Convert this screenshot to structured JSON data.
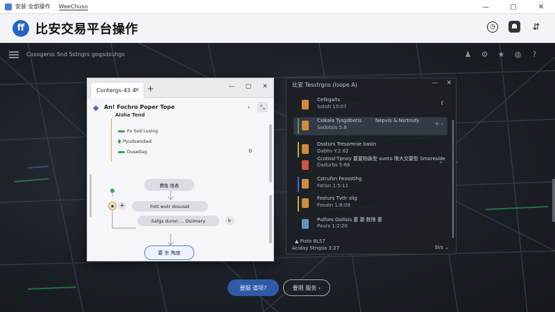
{
  "os_bar": {
    "app_name": "安装 全部操作",
    "tab_label": "WeeChuso",
    "minimize": "—",
    "maximize": "▢",
    "close": "✕"
  },
  "header": {
    "logo_glyph": "ff",
    "title": "比安交易平台操作",
    "icons": [
      "clock-icon",
      "bot-icon",
      "expand-icon"
    ]
  },
  "nav": {
    "breadcrumb": "Cosogerss Snd Sstngrs gogsdsuhgs",
    "icons": [
      "user-icon",
      "settings-icon",
      "star-icon",
      "globe-icon",
      "question-icon"
    ]
  },
  "left_window": {
    "tab_label": "Contergs-43 4",
    "tab_close": "×",
    "new_tab": "+",
    "controls": {
      "minimize": "—",
      "maximize": "▢",
      "close": "✕"
    },
    "title": "An! Fochro Poper Tope",
    "subtitle": "Aisha Tend",
    "tree_items": [
      "Fo Sod Lusing",
      "Pyudswsdwd",
      "Dusetlag"
    ],
    "tools": [
      "‹",
      "⤡"
    ],
    "flow": {
      "node_top": "費售 限表",
      "node_mid": "Fott   wutr dosuset",
      "node_low": "Safgs  duron ... Dsiimery",
      "node_low_badge": "b",
      "node_bottom": "要 东 陶度",
      "plus": "+"
    }
  },
  "right_panel": {
    "title": "比安 Tesstrgns (lsope A)",
    "controls": {
      "minimize": "—",
      "close": "✕"
    },
    "rows": [
      {
        "line1": "Cetkgaits",
        "line2": "Sotoh 15:07",
        "right": "ℓ",
        "color": "#d58a3b",
        "bar": ""
      },
      {
        "line1": "Cslkala Tysgdbetis",
        "line2": "Sodotsis 5:8",
        "right": "Nepvis & Nsrtnufy",
        "right2": "+ ›",
        "color": "#d58a3b",
        "bar": "#39a64a",
        "highlight": true
      },
      {
        "line1": "Dssturs Tresomnie basin",
        "line2": "Dabhs Y:2 62",
        "right": "",
        "color": "#d58a3b",
        "bar": "#d5a43b"
      },
      {
        "line1": "Ccotoal-Tpnoy 要要物装型 sunto 限大交要型 Smoreslde",
        "line2": "Dadurbs 5:66",
        "right": "⌄",
        "color": "#d3533b",
        "bar": ""
      },
      {
        "line1": "Cstrufsn Feosstihg",
        "line2": "Fatisn 1:5:11",
        "right": "",
        "color": "#d58a3b",
        "bar": "#3b6ed5"
      },
      {
        "line1": "Fosturs Tvtlr slig",
        "line2": "Fosatn 1:8:08",
        "right": "",
        "color": "#d58a3b",
        "bar": "#d5a43b"
      },
      {
        "line1": "Pulfors Gsilisis 要 要 数限 要",
        "line2": "Paurs 1:2:20",
        "right": "",
        "color": "#6b8fc9",
        "bar": ""
      }
    ],
    "footer1": "▲  Pisto 8L57",
    "footer2": "Aciday Stnqoa 3:27",
    "footer3": "Sl/s ⌄"
  },
  "actions": {
    "primary": "要服 道项?",
    "secondary": "要限 服务 ›"
  }
}
